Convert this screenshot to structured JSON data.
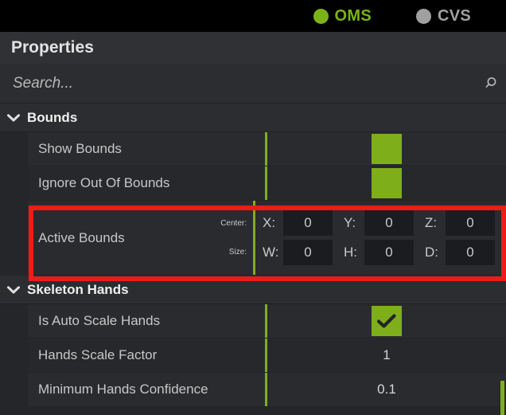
{
  "statusbar": {
    "items": [
      {
        "label": "OMS",
        "icon": "status-dot-icon",
        "color": "#7ab317"
      },
      {
        "label": "CVS",
        "icon": "status-dot-icon",
        "color": "#a0a0a0"
      }
    ]
  },
  "panel": {
    "title": "Properties"
  },
  "search": {
    "placeholder": "Search...",
    "value": "",
    "icon": "search-icon"
  },
  "accent_color": "#7fae1b",
  "highlight_color": "#ee1b1b",
  "sections": [
    {
      "name": "Bounds",
      "expanded": true,
      "chevron": "chevron-down-icon",
      "rows": [
        {
          "label": "Show Bounds",
          "type": "swatch",
          "value": ""
        },
        {
          "label": "Ignore Out Of Bounds",
          "type": "swatch",
          "value": ""
        },
        {
          "label": "Active Bounds",
          "type": "vector",
          "lines": [
            {
              "sublabel": "Center:",
              "fields": [
                {
                  "axis": "X:",
                  "value": "0"
                },
                {
                  "axis": "Y:",
                  "value": "0"
                },
                {
                  "axis": "Z:",
                  "value": "0"
                }
              ]
            },
            {
              "sublabel": "Size:",
              "fields": [
                {
                  "axis": "W:",
                  "value": "0"
                },
                {
                  "axis": "H:",
                  "value": "0"
                },
                {
                  "axis": "D:",
                  "value": "0"
                }
              ]
            }
          ]
        }
      ]
    },
    {
      "name": "Skeleton Hands",
      "expanded": true,
      "chevron": "chevron-down-icon",
      "rows": [
        {
          "label": "Is Auto Scale Hands",
          "type": "checkbox",
          "value": "checked"
        },
        {
          "label": "Hands Scale Factor",
          "type": "text",
          "value": "1"
        },
        {
          "label": "Minimum Hands Confidence",
          "type": "text",
          "value": "0.1"
        }
      ]
    }
  ]
}
